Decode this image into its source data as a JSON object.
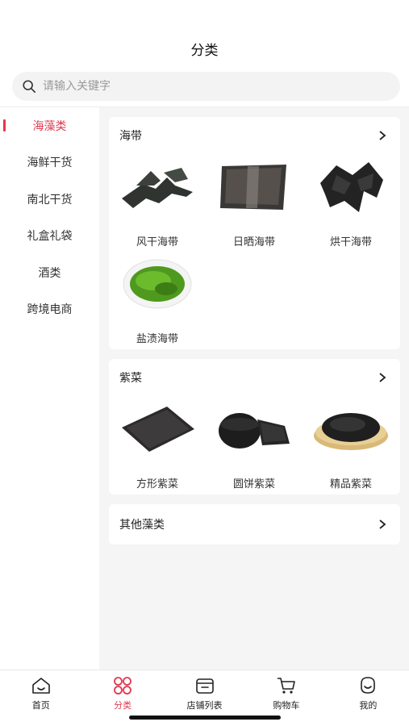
{
  "header": {
    "title": "分类"
  },
  "search": {
    "placeholder": "请输入关键字"
  },
  "sidebar": {
    "items": [
      {
        "label": "海藻类",
        "active": true
      },
      {
        "label": "海鲜干货"
      },
      {
        "label": "南北干货"
      },
      {
        "label": "礼盒礼袋"
      },
      {
        "label": "酒类"
      },
      {
        "label": "跨境电商"
      }
    ]
  },
  "sections": [
    {
      "title": "海带",
      "products": [
        "风干海带",
        "日晒海带",
        "烘干海带",
        "盐渍海带"
      ]
    },
    {
      "title": "紫菜",
      "products": [
        "方形紫菜",
        "圆饼紫菜",
        "精品紫菜"
      ]
    },
    {
      "title": "其他藻类"
    }
  ],
  "tabbar": {
    "tabs": [
      {
        "label": "首页",
        "icon": "home-icon"
      },
      {
        "label": "分类",
        "icon": "category-icon",
        "active": true
      },
      {
        "label": "店铺列表",
        "icon": "store-icon"
      },
      {
        "label": "购物车",
        "icon": "cart-icon"
      },
      {
        "label": "我的",
        "icon": "profile-icon"
      }
    ]
  },
  "colors": {
    "accent": "#e03a4e",
    "background": "#f5f5f5"
  }
}
